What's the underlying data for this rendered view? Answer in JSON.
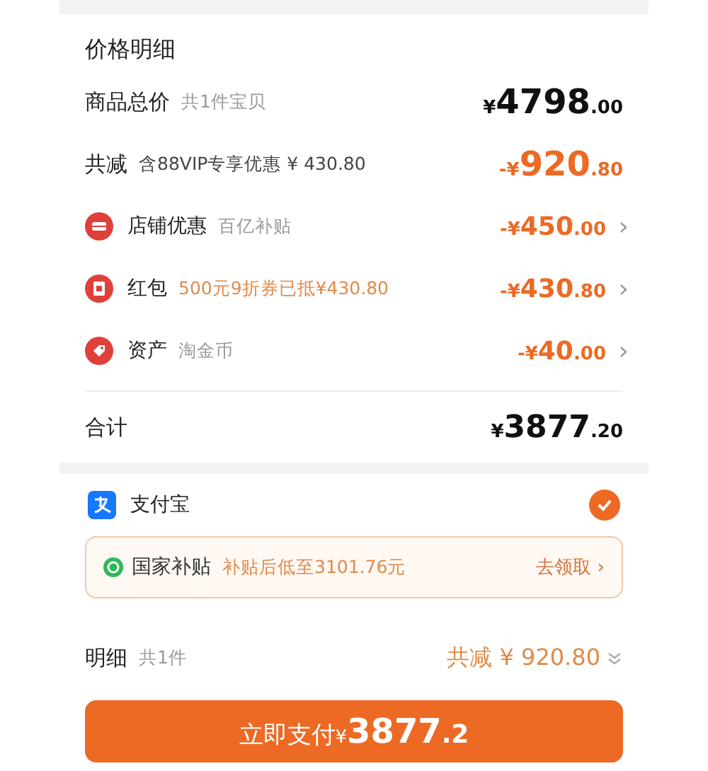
{
  "price_detail": {
    "title": "价格明细",
    "subtotal": {
      "label": "商品总价",
      "note": "共1件宝贝",
      "price": {
        "sign": "¥",
        "integer": "4798",
        "decimal": ".00"
      }
    },
    "reduction": {
      "label": "共减",
      "note": "含88VIP专享优惠 ¥ 430.80",
      "price": {
        "sign": "-¥",
        "integer": "920",
        "decimal": ".80"
      }
    },
    "discounts": [
      {
        "kind": "shop",
        "label": "店铺优惠",
        "note": "百亿补贴",
        "note_highlighted": false,
        "price": {
          "sign": "-¥",
          "integer": "450",
          "decimal": ".00"
        },
        "chevron": "›"
      },
      {
        "kind": "red-packet",
        "label": "红包",
        "note": "500元9折券已抵¥430.80",
        "note_highlighted": true,
        "price": {
          "sign": "-¥",
          "integer": "430",
          "decimal": ".80"
        },
        "chevron": "›"
      },
      {
        "kind": "asset",
        "label": "资产",
        "note": "淘金币",
        "note_highlighted": false,
        "price": {
          "sign": "-¥",
          "integer": "40",
          "decimal": ".00"
        },
        "chevron": "›"
      }
    ],
    "total": {
      "label": "合计",
      "price": {
        "sign": "¥",
        "integer": "3877",
        "decimal": ".20"
      }
    }
  },
  "payment": {
    "method": "支付宝",
    "selected": true
  },
  "subsidy": {
    "title": "国家补贴",
    "note": "补贴后低至3101.76元",
    "action": "去领取 ›"
  },
  "summary": {
    "label": "明细",
    "note": "共1件",
    "reduction": "共减 ¥ 920.80"
  },
  "pay_button": {
    "label": "立即支付",
    "sign": "¥",
    "integer": "3877",
    "decimal": ".2"
  }
}
